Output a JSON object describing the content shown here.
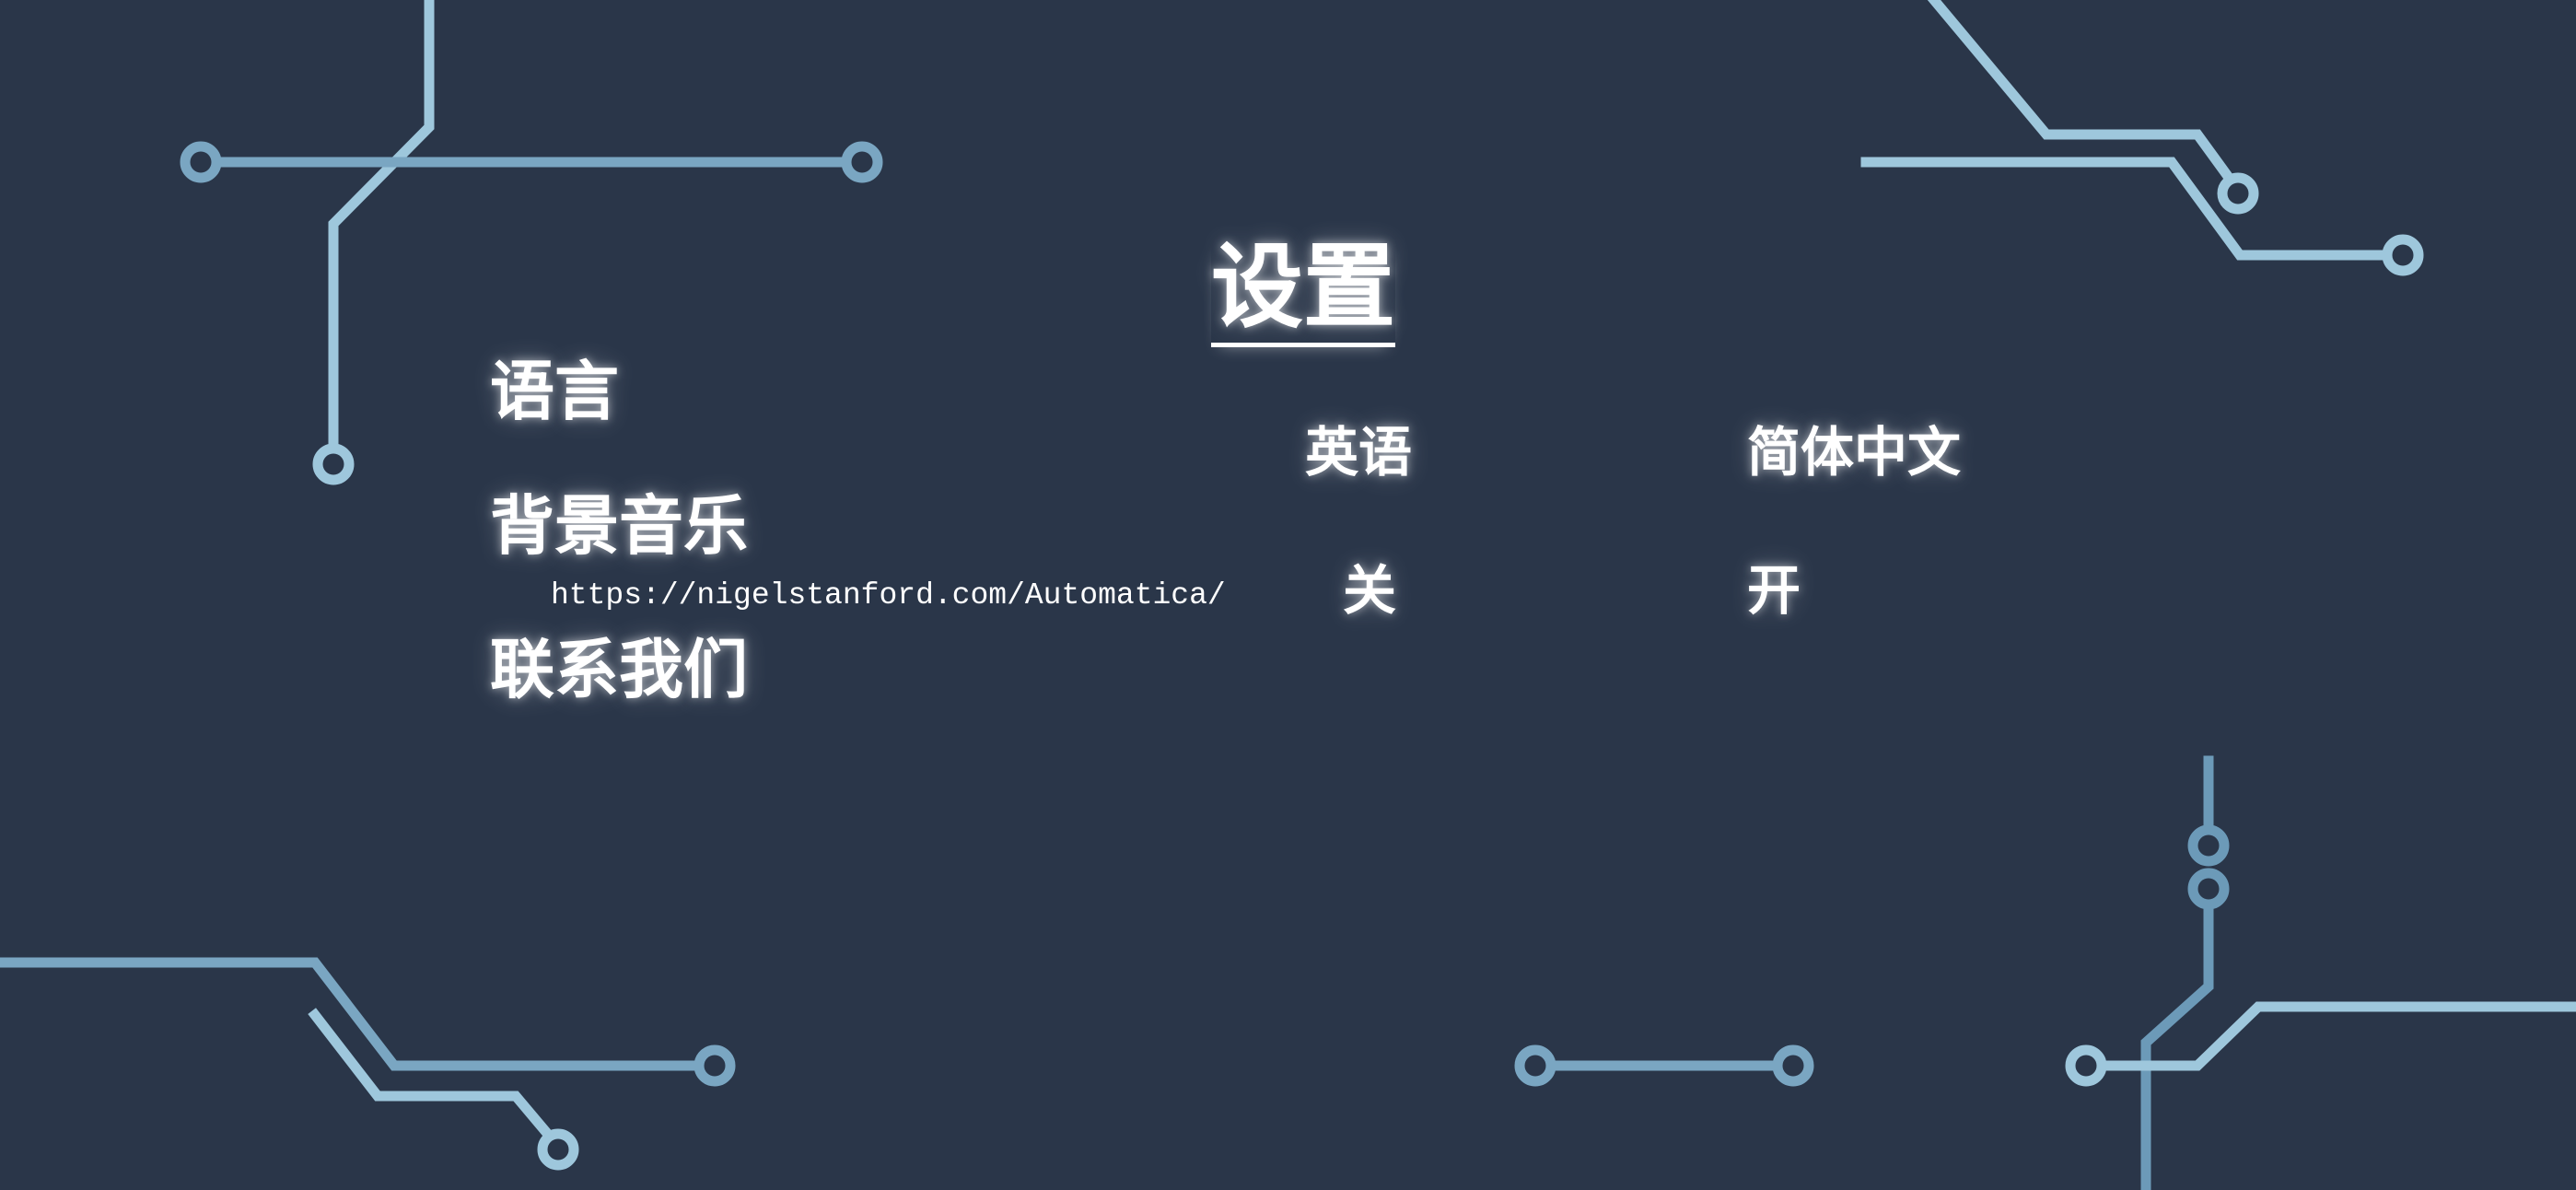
{
  "settings": {
    "title": "设置",
    "menu": {
      "language": "语言",
      "background_music": "背景音乐",
      "contact_us": "联系我们"
    },
    "language_options": {
      "english": "英语",
      "simplified_chinese": "简体中文"
    },
    "music_options": {
      "off": "关",
      "on": "开"
    },
    "contact_url": "https://nigelstanford.com/Automatica/"
  },
  "colors": {
    "background": "#2a3649",
    "circuit_light": "#9ec7dc",
    "circuit_mid": "#7aa6c2",
    "circuit_dark": "#6c9ab8",
    "text": "#ffffff"
  },
  "icons": [
    "circuit-trace-decoration"
  ]
}
